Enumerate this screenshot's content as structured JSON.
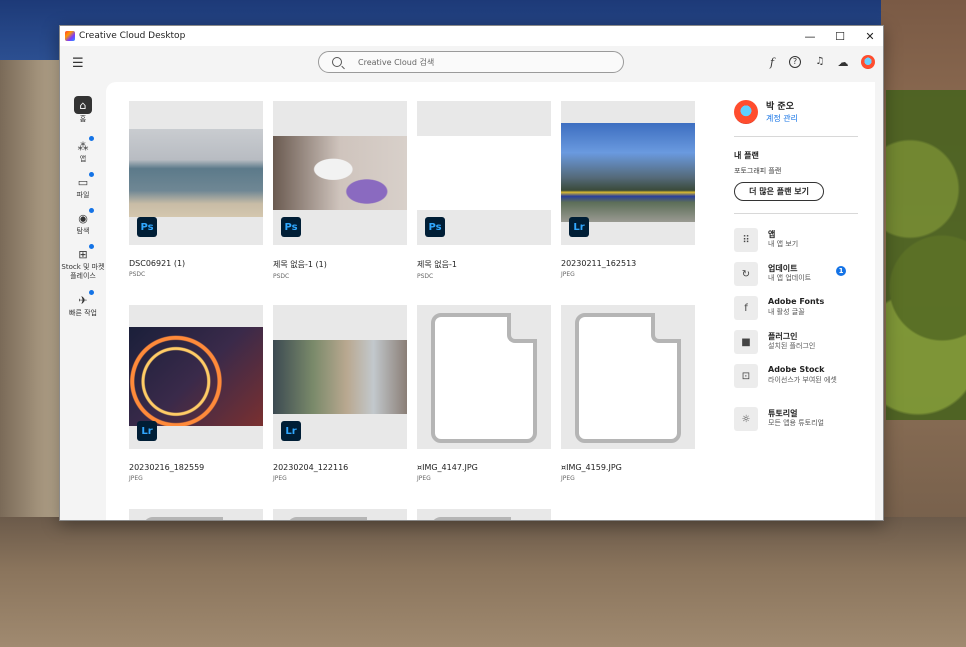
{
  "window": {
    "title": "Creative Cloud Desktop",
    "minimize": "—",
    "maximize": "☐",
    "close": "✕"
  },
  "toolbar": {
    "search_placeholder": "Creative Cloud 검색",
    "fonts_icon": "f",
    "help_icon": "?",
    "bell_icon": "🔔",
    "cloud_icon": "☁"
  },
  "sidebar": {
    "items": [
      {
        "label": "홈",
        "icon": "home-icon",
        "glyph": "⌂",
        "dot": false
      },
      {
        "label": "앱",
        "icon": "apps-icon",
        "glyph": "⁂",
        "dot": true
      },
      {
        "label": "파일",
        "icon": "folder-icon",
        "glyph": "▭",
        "dot": true
      },
      {
        "label": "탐색",
        "icon": "compass-icon",
        "glyph": "◉",
        "dot": true
      },
      {
        "label": "Stock 및 마켓플레이스",
        "icon": "store-icon",
        "glyph": "⊞",
        "dot": true
      },
      {
        "label": "빠른 작업",
        "icon": "rocket-icon",
        "glyph": "✈",
        "dot": true
      }
    ]
  },
  "files": [
    {
      "name": "DSC06921 (1)",
      "type": "PSDC",
      "app": "Ps",
      "thumb": "beach"
    },
    {
      "name": "제목 없음-1 (1)",
      "type": "PSDC",
      "app": "Ps",
      "thumb": "goat"
    },
    {
      "name": "제목 없음-1",
      "type": "PSDC",
      "app": "Ps",
      "thumb": "blank"
    },
    {
      "name": "20230211_162513",
      "type": "JPEG",
      "app": "Lr",
      "thumb": "train"
    },
    {
      "name": "20230216_182559",
      "type": "JPEG",
      "app": "Lr",
      "thumb": "wheel"
    },
    {
      "name": "20230204_122116",
      "type": "JPEG",
      "app": "Lr",
      "thumb": "street"
    },
    {
      "name": "¤IMG_4147.JPG",
      "type": "JPEG",
      "app": "",
      "thumb": "file"
    },
    {
      "name": "¤IMG_4159.JPG",
      "type": "JPEG",
      "app": "",
      "thumb": "file"
    }
  ],
  "account": {
    "name": "박 준오",
    "manage": "계정 관리"
  },
  "plan": {
    "title": "내 플랜",
    "name": "포토그래피 플랜",
    "more_button": "더 많은 플랜 보기"
  },
  "panel_items": [
    {
      "title": "앱",
      "sub": "내 앱 보기",
      "glyph": "⠿",
      "icon": "grid-icon",
      "badge": ""
    },
    {
      "title": "업데이트",
      "sub": "내 앱 업데이트",
      "glyph": "↻",
      "icon": "refresh-icon",
      "badge": "1"
    },
    {
      "title": "Adobe Fonts",
      "sub": "내 활성 글꼴",
      "glyph": "f",
      "icon": "fonts-icon",
      "badge": ""
    },
    {
      "title": "플러그인",
      "sub": "설치된 플러그인",
      "glyph": "■",
      "icon": "plugin-icon",
      "badge": ""
    },
    {
      "title": "Adobe Stock",
      "sub": "라이선스가 부여된 에셋",
      "glyph": "⊡",
      "icon": "stock-icon",
      "badge": ""
    },
    {
      "title": "튜토리얼",
      "sub": "모든 앱용 튜토리얼",
      "glyph": "☼",
      "icon": "lightbulb-icon",
      "badge": ""
    }
  ],
  "colors": {
    "accent": "#1473e6",
    "ps_badge_bg": "#001e36",
    "ps_badge_fg": "#31a8ff"
  }
}
